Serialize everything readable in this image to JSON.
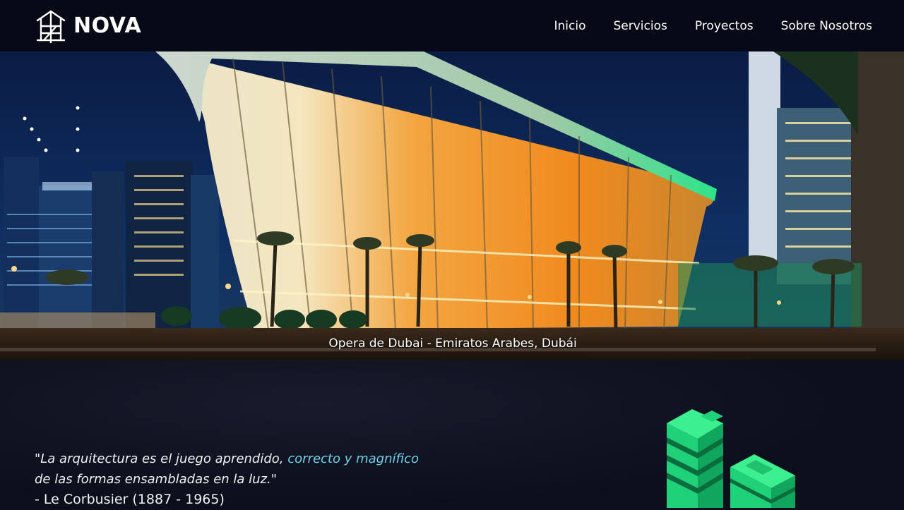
{
  "brand": {
    "name": "NOVA",
    "logo_icon": "house-frame-icon"
  },
  "nav": {
    "items": [
      {
        "label": "Inicio"
      },
      {
        "label": "Servicios"
      },
      {
        "label": "Proyectos"
      },
      {
        "label": "Sobre Nosotros"
      }
    ]
  },
  "hero": {
    "caption": "Opera de Dubai - Emiratos Arabes, Dubái"
  },
  "quote": {
    "line1_start": "\"La arquitectura es el juego aprendido, ",
    "line1_accent": "correcto y magnífico",
    "line2": "de las formas ensambladas en la luz.\"",
    "author": "- Le Corbusier (1887 - 1965)"
  },
  "colors": {
    "background": "#0b0e1b",
    "navbar": "#070a16",
    "accent": "#6fd1e6",
    "illustration_green": "#1fd27a"
  },
  "illustration": {
    "icon": "isometric-buildings-icon"
  }
}
